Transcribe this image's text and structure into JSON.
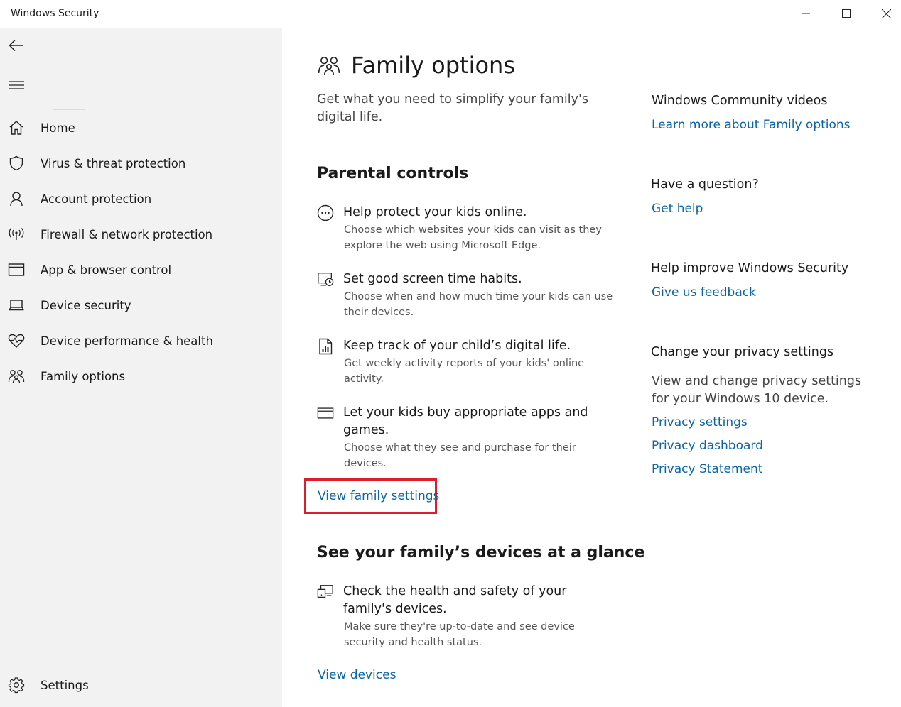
{
  "window": {
    "title": "Windows Security"
  },
  "sidebar": {
    "items": [
      {
        "label": "Home",
        "icon": "home-icon"
      },
      {
        "label": "Virus & threat protection",
        "icon": "shield-icon"
      },
      {
        "label": "Account protection",
        "icon": "person-icon"
      },
      {
        "label": "Firewall & network protection",
        "icon": "antenna-icon"
      },
      {
        "label": "App & browser control",
        "icon": "browser-window-icon"
      },
      {
        "label": "Device security",
        "icon": "laptop-icon"
      },
      {
        "label": "Device performance & health",
        "icon": "heart-pulse-icon"
      },
      {
        "label": "Family options",
        "icon": "family-icon"
      }
    ],
    "settings_label": "Settings"
  },
  "main": {
    "title": "Family options",
    "subtitle": "Get what you need to simplify your family's digital life.",
    "parental": {
      "heading": "Parental controls",
      "features": [
        {
          "title": "Help protect your kids online.",
          "desc": "Choose which websites your kids can visit as they explore the web using Microsoft Edge.",
          "icon": "globe-dots-icon"
        },
        {
          "title": "Set good screen time habits.",
          "desc": "Choose when and how much time your kids can use their devices.",
          "icon": "screen-clock-icon"
        },
        {
          "title": "Keep track of your child’s digital life.",
          "desc": "Get weekly activity reports of your kids' online activity.",
          "icon": "report-icon"
        },
        {
          "title": "Let your kids buy appropriate apps and games.",
          "desc": "Choose what they see and purchase for their devices.",
          "icon": "card-icon"
        }
      ],
      "link": "View family settings"
    },
    "devices": {
      "heading": "See your family’s devices at a glance",
      "feature": {
        "title": "Check the health and safety of your family's devices.",
        "desc": "Make sure they're up-to-date and see device security and health status.",
        "icon": "devices-icon"
      },
      "link": "View devices"
    }
  },
  "right": {
    "videos_title": "Windows Community videos",
    "videos_link": "Learn more about Family options",
    "question_title": "Have a question?",
    "question_link": "Get help",
    "improve_title": "Help improve Windows Security",
    "improve_link": "Give us feedback",
    "privacy_title": "Change your privacy settings",
    "privacy_text": "View and change privacy settings for your Windows 10 device.",
    "privacy_links": [
      "Privacy settings",
      "Privacy dashboard",
      "Privacy Statement"
    ]
  },
  "colors": {
    "link": "#0a64a6",
    "highlight": "#d9202a",
    "sidebar_bg": "#f2f2f2"
  }
}
